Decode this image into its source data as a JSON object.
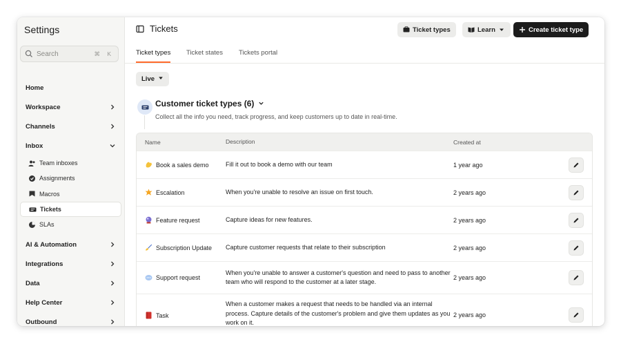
{
  "sidebar": {
    "title": "Settings",
    "search": {
      "placeholder": "Search",
      "shortcut": "⌘ K"
    },
    "items": [
      {
        "label": "Home"
      },
      {
        "label": "Workspace"
      },
      {
        "label": "Channels"
      },
      {
        "label": "Inbox"
      }
    ],
    "inbox_subitems": [
      {
        "label": "Team inboxes",
        "icon": "users-icon"
      },
      {
        "label": "Assignments",
        "icon": "assignments-icon"
      },
      {
        "label": "Macros",
        "icon": "macros-icon"
      },
      {
        "label": "Tickets",
        "icon": "ticket-icon",
        "active": true
      },
      {
        "label": "SLAs",
        "icon": "sla-icon"
      }
    ],
    "lower_items": [
      {
        "label": "AI & Automation"
      },
      {
        "label": "Integrations"
      },
      {
        "label": "Data"
      },
      {
        "label": "Help Center"
      },
      {
        "label": "Outbound"
      }
    ]
  },
  "header": {
    "title": "Tickets",
    "ticket_types_button": "Ticket types",
    "learn_button": "Learn",
    "create_button": "Create ticket type"
  },
  "tabs": [
    {
      "label": "Ticket types",
      "active": true
    },
    {
      "label": "Ticket states"
    },
    {
      "label": "Tickets portal"
    }
  ],
  "filter": {
    "label": "Live"
  },
  "section": {
    "title": "Customer ticket types (6)",
    "description": "Collect all the info you need, track progress, and keep customers up to date in real-time."
  },
  "table": {
    "columns": [
      "Name",
      "Description",
      "Created at"
    ],
    "rows": [
      {
        "name": "Book a sales demo",
        "icon": "waving-hand-icon",
        "description": "Fill it out to book a demo with our team",
        "created": "1 year ago"
      },
      {
        "name": "Escalation",
        "icon": "star-burst-icon",
        "description": "When you're unable to resolve an issue on first touch.",
        "created": "2 years ago"
      },
      {
        "name": "Feature request",
        "icon": "crystal-ball-icon",
        "description": "Capture ideas for new features.",
        "created": "2 years ago"
      },
      {
        "name": "Subscription Update",
        "icon": "writing-hand-icon",
        "description": "Capture customer requests that relate to their subscription",
        "created": "2 years ago"
      },
      {
        "name": "Support request",
        "icon": "speech-bubble-icon",
        "description": "When you're unable to answer a customer's question and need to pass to another team who will respond to the customer at a later stage.",
        "created": "2 years ago"
      },
      {
        "name": "Task",
        "icon": "red-book-icon",
        "description": "When a customer makes a request that needs to be handled via an internal process. Capture details of the customer's problem and give them updates as you work on it.",
        "created": "2 years ago"
      }
    ]
  },
  "colors": {
    "accent": "#ff6a2b",
    "dark_button": "#1c1c1c",
    "sidebar_bg": "#f6f6f4"
  }
}
